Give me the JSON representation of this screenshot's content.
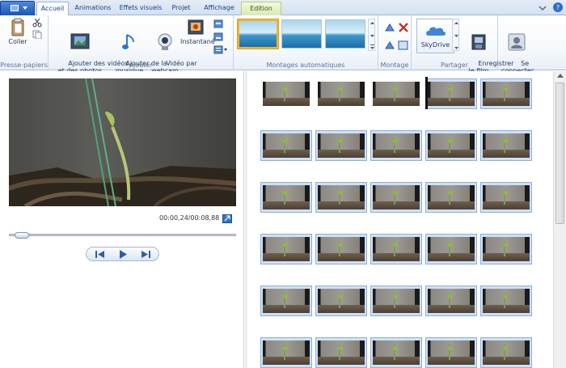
{
  "tabs": [
    {
      "label": "Accueil",
      "active": true
    },
    {
      "label": "Animations"
    },
    {
      "label": "Effets visuels"
    },
    {
      "label": "Projet"
    },
    {
      "label": "Affichage"
    },
    {
      "label": "Edition",
      "contextual": true
    }
  ],
  "ribbon": {
    "clipboard": {
      "paste_label": "Coller",
      "group_label": "Presse-papiers"
    },
    "add": {
      "add_videos_label": "Ajouter des vidéos\net des photos",
      "add_music_label": "Ajouter de la\nmusique",
      "webcam_label": "Vidéo par\nwebcam",
      "snapshot_label": "Instantané",
      "group_label": "Ajouter"
    },
    "automovie": {
      "group_label": "Montages automatiques"
    },
    "editing": {
      "group_label": "Montage"
    },
    "share": {
      "skydrive_label": "SkyDrive",
      "save_movie_label": "Enregistrer\nle film",
      "group_label": "Partager"
    },
    "signin": {
      "label": "Se\nconnecter"
    }
  },
  "preview": {
    "timecode": "00:00,24/00:08,88",
    "progress": 0.027
  },
  "storyboard": {
    "rows": 6,
    "columns": 5,
    "clip_count": 30
  }
}
